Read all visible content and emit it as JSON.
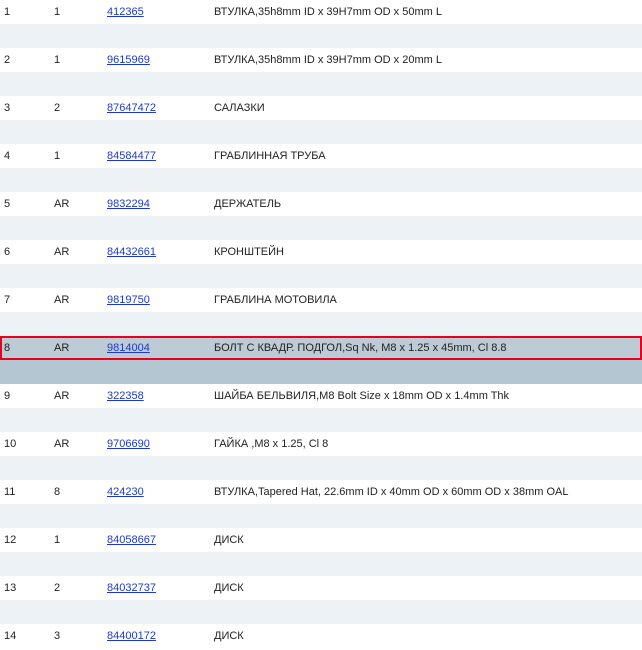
{
  "rows": [
    {
      "num": "1",
      "qty": "1",
      "part": "412365",
      "desc": "ВТУЛКА,35h8mm ID x 39H7mm OD x 50mm L"
    },
    {
      "num": "2",
      "qty": "1",
      "part": "9615969",
      "desc": "ВТУЛКА,35h8mm ID x 39H7mm OD x 20mm L"
    },
    {
      "num": "3",
      "qty": "2",
      "part": "87647472",
      "desc": "САЛАЗКИ"
    },
    {
      "num": "4",
      "qty": "1",
      "part": "84584477",
      "desc": "ГРАБЛИННАЯ ТРУБА"
    },
    {
      "num": "5",
      "qty": "AR",
      "part": "9832294",
      "desc": "ДЕРЖАТЕЛЬ"
    },
    {
      "num": "6",
      "qty": "AR",
      "part": "84432661",
      "desc": "КРОНШТЕЙН"
    },
    {
      "num": "7",
      "qty": "AR",
      "part": "9819750",
      "desc": "ГРАБЛИНА МОТОВИЛА"
    },
    {
      "num": "8",
      "qty": "AR",
      "part": "9814004",
      "desc": "БОЛТ С КВАДР. ПОДГОЛ,Sq Nk, M8 x 1.25 x 45mm, Cl 8.8"
    },
    {
      "num": "9",
      "qty": "AR",
      "part": "322358",
      "desc": "ШАЙБА БЕЛЬВИЛЯ,M8 Bolt Size x 18mm OD x 1.4mm Thk"
    },
    {
      "num": "10",
      "qty": "AR",
      "part": "9706690",
      "desc": "ГАЙКА ,M8 x 1.25, Cl 8"
    },
    {
      "num": "11",
      "qty": "8",
      "part": "424230",
      "desc": "ВТУЛКА,Tapered Hat, 22.6mm ID x 40mm OD x 60mm OD x 38mm OAL"
    },
    {
      "num": "12",
      "qty": "1",
      "part": "84058667",
      "desc": "ДИСК"
    },
    {
      "num": "13",
      "qty": "2",
      "part": "84032737",
      "desc": "ДИСК"
    },
    {
      "num": "14",
      "qty": "3",
      "part": "84400172",
      "desc": "ДИСК"
    }
  ],
  "selected_index": 7,
  "colors": {
    "link": "#1f3bc4",
    "selected_row": "#bccbd6",
    "highlight_border": "#e8001c",
    "gap_row": "#edf2f7"
  }
}
